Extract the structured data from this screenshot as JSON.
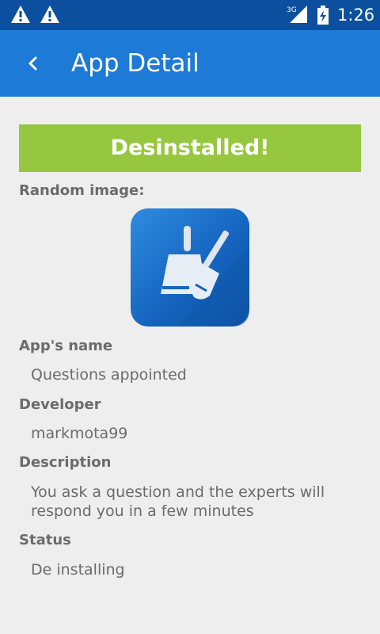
{
  "status_bar": {
    "network": "3G",
    "time": "1:26"
  },
  "app_bar": {
    "title": "App Detail"
  },
  "banner": {
    "text": "Desinstalled!",
    "color": "#96c73f"
  },
  "random_image": {
    "label": "Random image:",
    "icon": "cleaner-broom-icon"
  },
  "details": {
    "name_label": "App's name",
    "name_value": "Questions appointed",
    "developer_label": "Developer",
    "developer_value": "markmota99",
    "description_label": "Description",
    "description_value": "You ask a question and the experts will respond you in a few minutes",
    "status_label": "Status",
    "status_value": "De installing"
  },
  "colors": {
    "status_bar": "#0c4f9e",
    "app_bar": "#1d7ad7",
    "background": "#eeeeee",
    "text": "#6b6b6b"
  }
}
